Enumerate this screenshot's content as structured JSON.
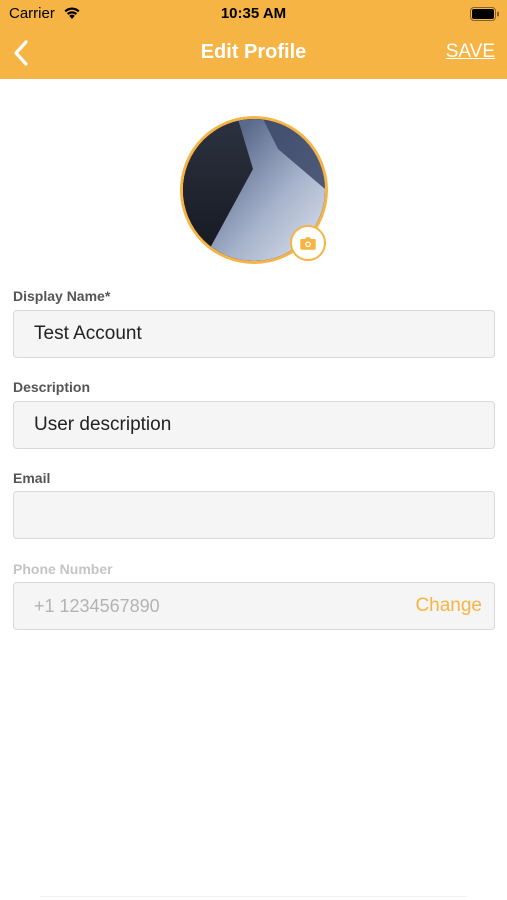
{
  "status_bar": {
    "carrier": "Carrier",
    "time": "10:35 AM"
  },
  "nav": {
    "title": "Edit Profile",
    "save_label": "SAVE"
  },
  "form": {
    "display_name": {
      "label": "Display Name*",
      "value": "Test Account"
    },
    "description": {
      "label": "Description",
      "value": "User description"
    },
    "email": {
      "label": "Email",
      "value": ""
    },
    "phone": {
      "label": "Phone Number",
      "value": "+1 1234567890",
      "action_label": "Change"
    }
  },
  "colors": {
    "accent": "#f6b444",
    "header_text": "#ffffff",
    "field_background": "#f5f5f5"
  },
  "icons": {
    "back": "chevron-left-icon",
    "wifi": "wifi-icon",
    "battery": "battery-icon",
    "avatar_edit": "camera-icon"
  }
}
